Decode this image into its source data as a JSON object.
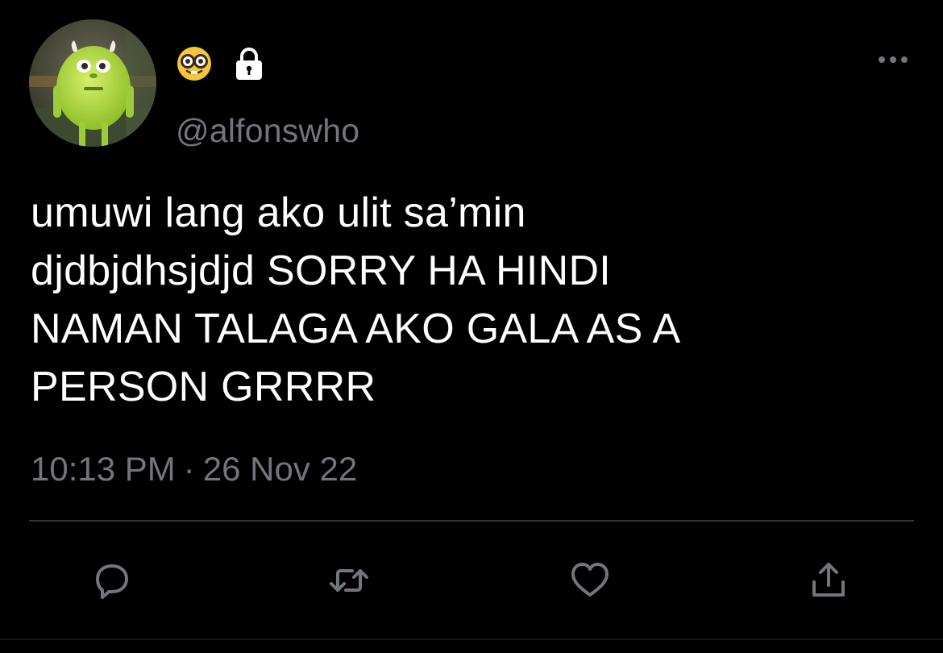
{
  "tweet": {
    "display_name_emoji": "🤓",
    "protected_icon": "lock-icon",
    "handle": "@alfonswho",
    "text": "umuwi lang ako ulit sa’min\ndjdbjdhsjdjd SORRY HA HINDI\nNAMAN TALAGA AKO GALA AS A\nPERSON GRRRR",
    "time": "10:13 PM",
    "separator": "·",
    "date": "26 Nov 22"
  },
  "actions": [
    {
      "icon": "reply-icon"
    },
    {
      "icon": "retweet-icon"
    },
    {
      "icon": "like-icon"
    },
    {
      "icon": "share-icon"
    }
  ],
  "colors": {
    "background": "#000000",
    "primary_text": "#ffffff",
    "secondary_text": "#71767b",
    "divider": "#2f3336",
    "icon": "#71767b"
  }
}
